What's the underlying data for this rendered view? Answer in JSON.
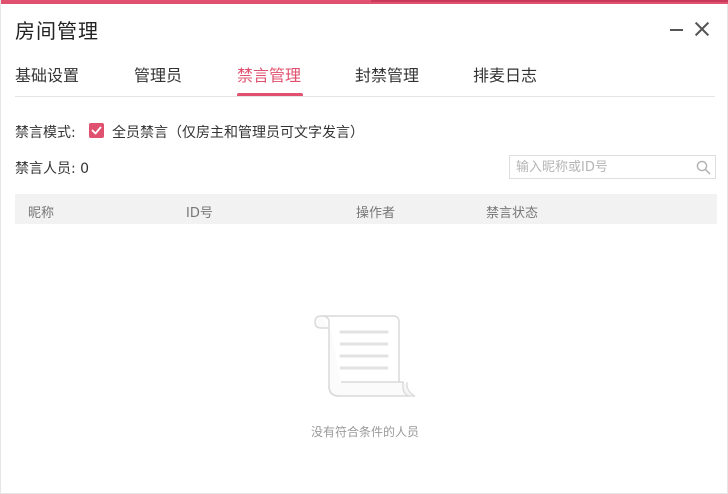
{
  "window": {
    "title": "房间管理",
    "accent_color": "#e0516f",
    "controls": {
      "minimize_icon": "minimize-icon",
      "close_icon": "close-icon"
    }
  },
  "tabs": [
    {
      "label": "基础设置",
      "active": false
    },
    {
      "label": "管理员",
      "active": false
    },
    {
      "label": "禁言管理",
      "active": true
    },
    {
      "label": "封禁管理",
      "active": false
    },
    {
      "label": "排麦日志",
      "active": false
    }
  ],
  "mute_settings": {
    "mode_label": "禁言模式:",
    "all_mute_checked": true,
    "all_mute_label": "全员禁言（仅房主和管理员可文字发言）",
    "muted_count_label": "禁言人员: 0"
  },
  "search": {
    "placeholder": "输入昵称或ID号",
    "value": "",
    "icon": "search-icon"
  },
  "table": {
    "columns": [
      "昵称",
      "ID号",
      "操作者",
      "禁言状态"
    ],
    "rows": []
  },
  "empty_state": {
    "icon": "scroll-document-icon",
    "message": "没有符合条件的人员"
  }
}
